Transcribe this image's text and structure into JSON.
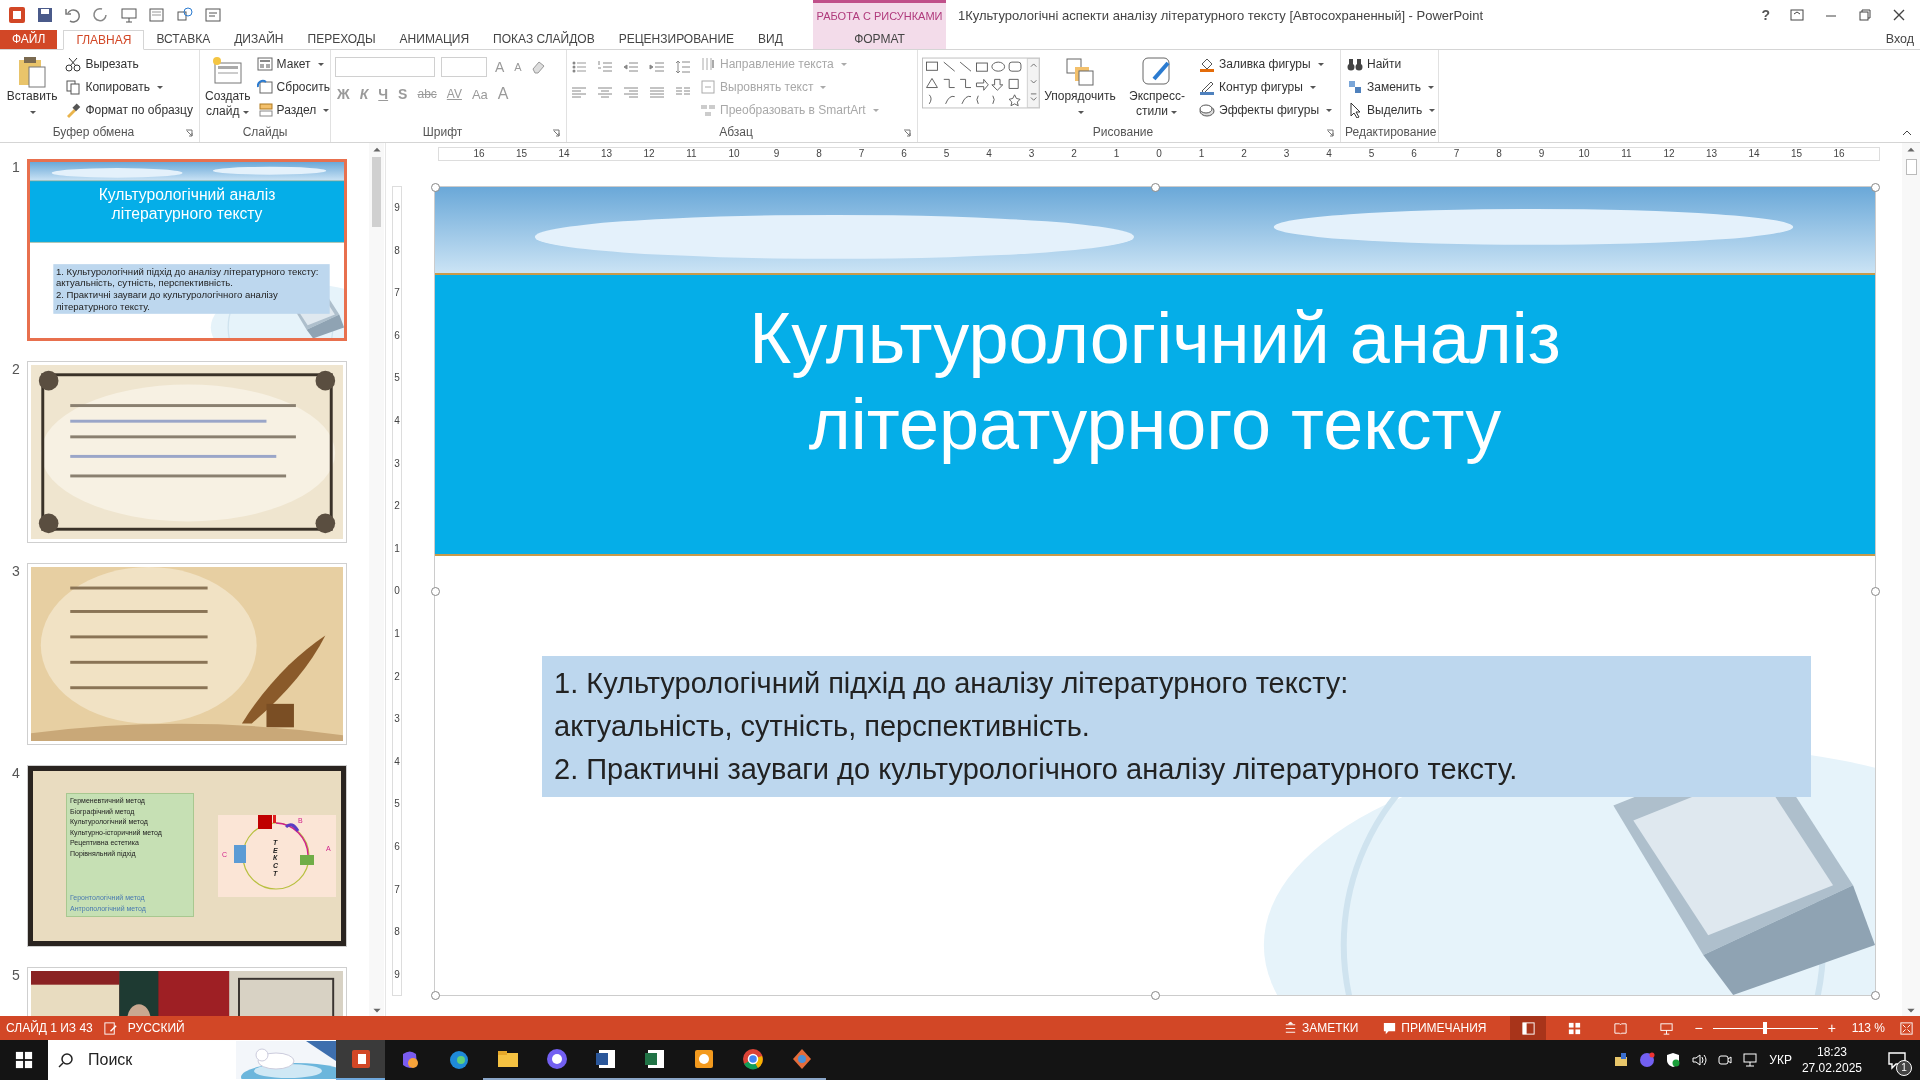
{
  "window": {
    "title": "1Культурологічні аспекти аналізу літературного тексту [Автосохраненный] - PowerPoint",
    "context_group": "РАБОТА С РИСУНКАМИ",
    "help": "?",
    "sign_in": "Вход"
  },
  "ribbon_tabs": [
    {
      "label": "ФАЙЛ",
      "kind": "file",
      "selected": false
    },
    {
      "label": "ГЛАВНАЯ",
      "kind": "tab",
      "selected": true
    },
    {
      "label": "ВСТАВКА",
      "kind": "tab",
      "selected": false
    },
    {
      "label": "ДИЗАЙН",
      "kind": "tab",
      "selected": false
    },
    {
      "label": "ПЕРЕХОДЫ",
      "kind": "tab",
      "selected": false
    },
    {
      "label": "АНИМАЦИЯ",
      "kind": "tab",
      "selected": false
    },
    {
      "label": "ПОКАЗ СЛАЙДОВ",
      "kind": "tab",
      "selected": false
    },
    {
      "label": "РЕЦЕНЗИРОВАНИЕ",
      "kind": "tab",
      "selected": false
    },
    {
      "label": "ВИД",
      "kind": "tab",
      "selected": false
    },
    {
      "label": "ФОРМАТ",
      "kind": "context",
      "selected": false
    }
  ],
  "ribbon_groups": [
    {
      "name": "Буфер обмена",
      "kind": "commands",
      "launcher": true,
      "commands": [
        {
          "label": "Вставить",
          "kind": "large",
          "menu": true,
          "disabled": false
        },
        {
          "label": "Вырезать",
          "kind": "small",
          "menu": false,
          "disabled": false
        },
        {
          "label": "Копировать",
          "kind": "small",
          "menu": true,
          "disabled": false
        },
        {
          "label": "Формат по образцу",
          "kind": "small",
          "menu": false,
          "disabled": false
        }
      ]
    },
    {
      "name": "Слайды",
      "kind": "commands",
      "launcher": false,
      "commands": [
        {
          "label": "Создать слайд",
          "kind": "large",
          "menu": true,
          "disabled": false
        },
        {
          "label": "Макет",
          "kind": "small",
          "menu": true,
          "disabled": false
        },
        {
          "label": "Сбросить",
          "kind": "small",
          "menu": false,
          "disabled": false
        },
        {
          "label": "Раздел",
          "kind": "small",
          "menu": true,
          "disabled": false
        }
      ]
    },
    {
      "name": "Шрифт",
      "kind": "font",
      "launcher": true,
      "size_glyphs": [
        "A",
        "A"
      ],
      "glyphs": [
        "Ж",
        "К",
        "Ч",
        "S",
        "abc",
        "AV",
        "Aa",
        "A"
      ]
    },
    {
      "name": "Абзац",
      "kind": "paragraph",
      "launcher": true,
      "commands": [
        {
          "label": "Направление текста",
          "kind": "small",
          "menu": true,
          "disabled": true
        },
        {
          "label": "Выровнять текст",
          "kind": "small",
          "menu": true,
          "disabled": true
        },
        {
          "label": "Преобразовать в SmartArt",
          "kind": "small",
          "menu": true,
          "disabled": true
        }
      ]
    },
    {
      "name": "Рисование",
      "kind": "drawing",
      "launcher": true,
      "commands": [
        {
          "label": "Упорядочить",
          "kind": "large",
          "menu": true,
          "disabled": false
        },
        {
          "label": "Экспресс-стили",
          "kind": "large",
          "menu": true,
          "disabled": false
        },
        {
          "label": "Заливка фигуры",
          "kind": "small",
          "menu": true,
          "disabled": false
        },
        {
          "label": "Контур фигуры",
          "kind": "small",
          "menu": true,
          "disabled": false
        },
        {
          "label": "Эффекты фигуры",
          "kind": "small",
          "menu": true,
          "disabled": false
        }
      ]
    },
    {
      "name": "Редактирование",
      "kind": "commands",
      "launcher": false,
      "commands": [
        {
          "label": "Найти",
          "kind": "small",
          "menu": false,
          "disabled": false
        },
        {
          "label": "Заменить",
          "kind": "small",
          "menu": true,
          "disabled": false
        },
        {
          "label": "Выделить",
          "kind": "small",
          "menu": true,
          "disabled": false
        }
      ]
    }
  ],
  "slides": [
    {
      "number": "1",
      "selected": true,
      "kind": "title",
      "title": "Культурологічний аналіз літературного тексту",
      "body": [
        "1.  Культурологічний підхід до аналізу літературного тексту:",
        "актуальність, сутність, перспективність.",
        "2. Практичні зауваги до культурологічного аналізу літературного тексту."
      ]
    },
    {
      "number": "2",
      "selected": false,
      "kind": "picture"
    },
    {
      "number": "3",
      "selected": false,
      "kind": "picture"
    },
    {
      "number": "4",
      "selected": false,
      "kind": "methods",
      "methods": [
        "Герменевтичний метод",
        "Біографічний метод",
        "Культурологічний метод",
        "Культурно-історичний метод",
        "Рецептивна естетика",
        "Порівняльний підхід"
      ],
      "extra_methods": [
        "Геронтологічний метод",
        "Антропологічний метод"
      ],
      "diagram_word": "ТЕКСТ",
      "diagram_labels": [
        "В",
        "А",
        "С"
      ]
    },
    {
      "number": "5",
      "selected": false,
      "kind": "picture"
    }
  ],
  "ruler": {
    "horizontal": [
      "16",
      "15",
      "14",
      "13",
      "12",
      "11",
      "10",
      "9",
      "8",
      "7",
      "6",
      "5",
      "4",
      "3",
      "2",
      "1",
      "0",
      "1",
      "2",
      "3",
      "4",
      "5",
      "6",
      "7",
      "8",
      "9",
      "10",
      "11",
      "12",
      "13",
      "14",
      "15",
      "16"
    ],
    "vertical": [
      "9",
      "8",
      "7",
      "6",
      "5",
      "4",
      "3",
      "2",
      "1",
      "0",
      "1",
      "2",
      "3",
      "4",
      "5",
      "6",
      "7",
      "8",
      "9"
    ]
  },
  "slide": {
    "title": "Культурологічний аналіз літературного тексту",
    "body": [
      "1.  Культурологічний підхід до аналізу літературного тексту:",
      "актуальність, сутність, перспективність.",
      "2. Практичні зауваги до культурологічного аналізу літературного тексту."
    ]
  },
  "status_bar": {
    "slide_counter": "СЛАЙД 1 ИЗ 43",
    "language": "РУССКИЙ",
    "notes": "ЗАМЕТКИ",
    "comments": "ПРИМЕЧАНИЯ",
    "views": [
      {
        "kind": "normal",
        "selected": true
      },
      {
        "kind": "sorter",
        "selected": false
      },
      {
        "kind": "reading",
        "selected": false
      },
      {
        "kind": "show",
        "selected": false
      }
    ],
    "zoom": {
      "level": 0.5,
      "label": "113 %",
      "out": "−",
      "in": "+"
    }
  },
  "taskbar": {
    "search_placeholder": "Поиск",
    "apps": [
      {
        "kind": "presentation",
        "active": true,
        "running": true
      },
      {
        "kind": "assistant",
        "active": false,
        "running": false
      },
      {
        "kind": "browser",
        "active": false,
        "running": false
      },
      {
        "kind": "folder",
        "active": false,
        "running": true
      },
      {
        "kind": "messenger",
        "active": false,
        "running": true
      },
      {
        "kind": "document",
        "active": false,
        "running": true
      },
      {
        "kind": "spreadsheet",
        "active": false,
        "running": true
      },
      {
        "kind": "pdf",
        "active": false,
        "running": true
      },
      {
        "kind": "browser2",
        "active": false,
        "running": true
      },
      {
        "kind": "viewer",
        "active": false,
        "running": true
      }
    ],
    "keyboard": "УКР",
    "time": "18:23",
    "date": "27.02.2025",
    "notifications": "1"
  }
}
